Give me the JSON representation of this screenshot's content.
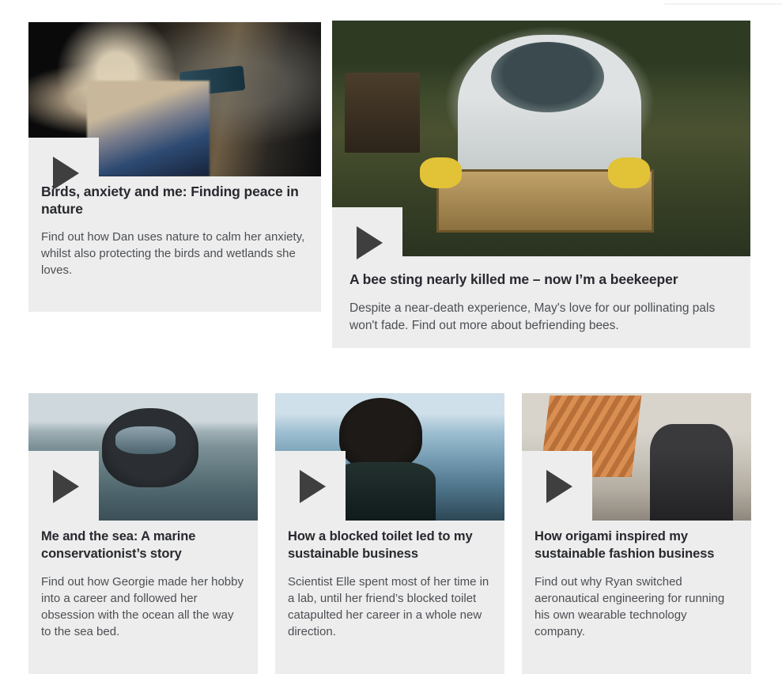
{
  "page": {
    "background_color": "#ffffff",
    "card_background_color": "#ededed",
    "title_color": "#27292e",
    "summary_color": "#4c4f54",
    "play_icon_color": "#3f3f3f"
  },
  "cards": [
    {
      "id": "card-birds",
      "title": "Birds, anxiety and me: Finding peace in nature",
      "summary": "Find out how Dan uses nature to calm her anxiety, whilst also protecting the birds and wetlands she loves.",
      "media_kind": "video",
      "play_icon": "play-icon",
      "image_alt": "Woman in knitted bobble hat looking through binoculars out of a hide window"
    },
    {
      "id": "card-bee",
      "title": "A bee sting nearly killed me – now I’m a beekeeper",
      "summary": "Despite a near-death experience, May's love for our pollinating pals won't fade. Find out more about befriending bees.",
      "media_kind": "video",
      "play_icon": "play-icon",
      "image_alt": "Beekeeper in white protective suit and yellow gloves lifting a frame from a hive"
    },
    {
      "id": "card-sea",
      "title": "Me and the sea: A marine conservationist’s story",
      "summary": "Find out how Georgie made her hobby into a career and followed her obsession with the ocean all the way to the sea bed.",
      "media_kind": "video",
      "play_icon": "play-icon",
      "image_alt": "Diver in mask and regulator surfacing in grey sea water"
    },
    {
      "id": "card-toilet",
      "title": "How a blocked toilet led to my sustainable business",
      "summary": "Scientist Elle spent most of her time in a lab, until her friend’s blocked toilet catapulted her career in a whole new direction.",
      "media_kind": "video",
      "play_icon": "play-icon",
      "image_alt": "Woman with updo hair standing in a glass-walled modern office"
    },
    {
      "id": "card-origami",
      "title": "How origami inspired my sustainable fashion business",
      "summary": "Find out why Ryan switched aeronautical engineering for running his own wearable technology company.",
      "media_kind": "video",
      "play_icon": "play-icon",
      "image_alt": "Man in a cap holding up a pleated orange origami-style fabric panel in a workshop"
    }
  ]
}
